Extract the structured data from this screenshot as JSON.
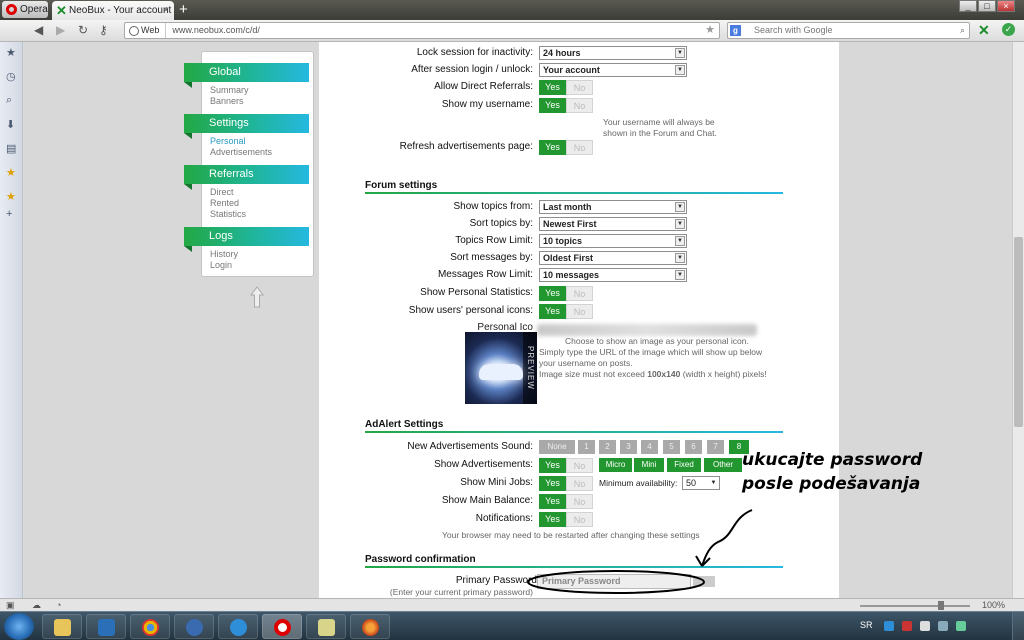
{
  "browser": {
    "opera_label": "Opera",
    "tab_title": "NeoBux - Your account",
    "web_label": "Web",
    "url": "www.neobux.com/c/d/",
    "search_placeholder": "Search with Google"
  },
  "menu": {
    "sections": [
      {
        "head": "Global",
        "items": [
          "Summary",
          "Banners"
        ]
      },
      {
        "head": "Settings",
        "items": [
          "Personal",
          "Advertisements"
        ]
      },
      {
        "head": "Referrals",
        "items": [
          "Direct",
          "Rented",
          "Statistics"
        ]
      },
      {
        "head": "Logs",
        "items": [
          "History",
          "Login"
        ]
      }
    ],
    "active_item": "Personal"
  },
  "account": {
    "lock_label": "Lock session for inactivity:",
    "lock_value": "24 hours",
    "after_label": "After session login / unlock:",
    "after_value": "Your account",
    "allow_label": "Allow Direct Referrals:",
    "show_username_label": "Show my username:",
    "username_hint_1": "Your username will always be",
    "username_hint_2": "shown in the Forum and Chat.",
    "refresh_label": "Refresh advertisements page:"
  },
  "toggle": {
    "yes": "Yes",
    "no": "No"
  },
  "forum": {
    "title": "Forum settings",
    "topics_from_label": "Show topics from:",
    "topics_from_value": "Last month",
    "sort_topics_label": "Sort topics by:",
    "sort_topics_value": "Newest First",
    "topics_limit_label": "Topics Row Limit:",
    "topics_limit_value": "10 topics",
    "sort_messages_label": "Sort messages by:",
    "sort_messages_value": "Oldest First",
    "messages_limit_label": "Messages Row Limit:",
    "messages_limit_value": "10 messages",
    "personal_stats_label": "Show Personal Statistics:",
    "users_icons_label": "Show users' personal icons:",
    "personal_icon_label": "Personal Ico",
    "icon_hint_1": "Choose to show an image as your personal icon.",
    "icon_hint_2": "Simply type the URL of the image which will show up below",
    "icon_hint_3": "your username on posts.",
    "icon_hint_4": "Image size must not exceed",
    "icon_hint_size": "100x140",
    "icon_hint_5": "(width x height) pixels!",
    "preview_label": "PREVIEW"
  },
  "adalert": {
    "title": "AdAlert Settings",
    "sound_label": "New Advertisements Sound:",
    "sound_options": [
      "None",
      "1",
      "2",
      "3",
      "4",
      "5",
      "6",
      "7",
      "8"
    ],
    "sound_selected": "8",
    "show_ads_label": "Show Advertisements:",
    "ad_types": [
      "Micro",
      "Mini",
      "Fixed",
      "Other"
    ],
    "mini_jobs_label": "Show Mini Jobs:",
    "min_avail_label": "Minimum availability:",
    "min_avail_value": "50",
    "main_balance_label": "Show Main Balance:",
    "notifications_label": "Notifications:",
    "restart_hint": "Your browser may need to be restarted after changing these settings"
  },
  "password": {
    "title": "Password confirmation",
    "primary_label": "Primary Password",
    "primary_hint": "(Enter your current primary password)",
    "placeholder": "Primary Password"
  },
  "annotation": {
    "line1": "ukucajte password",
    "line2": "posle podešavanja"
  },
  "statusbar": {
    "zoom": "100%"
  },
  "taskbar": {
    "lang": "SR"
  }
}
